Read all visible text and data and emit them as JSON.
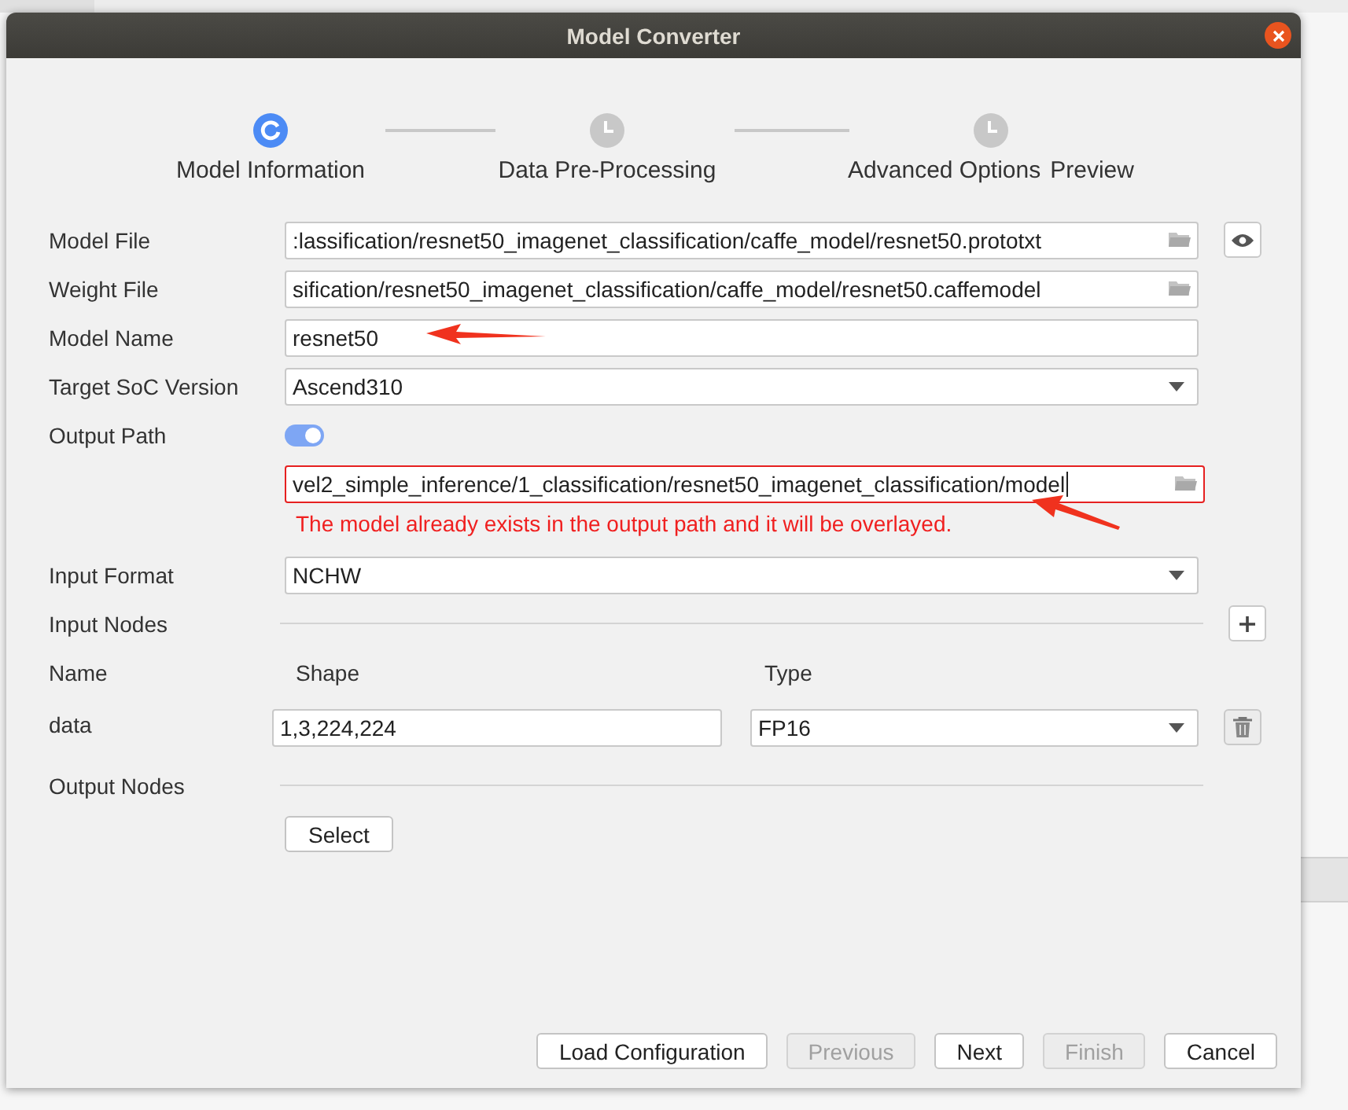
{
  "window": {
    "title": "Model Converter"
  },
  "steps": [
    {
      "label": "Model Information",
      "selected": true
    },
    {
      "label": "Data Pre-Processing",
      "selected": false
    },
    {
      "label": "Advanced Options",
      "selected": false
    }
  ],
  "trailing_step_label": "Preview",
  "model_file": {
    "label": "Model File",
    "value": ":lassification/resnet50_imagenet_classification/caffe_model/resnet50.prototxt"
  },
  "weight_file": {
    "label": "Weight File",
    "value": "sification/resnet50_imagenet_classification/caffe_model/resnet50.caffemodel"
  },
  "model_name": {
    "label": "Model Name",
    "value": "resnet50"
  },
  "target_soc": {
    "label": "Target SoC Version",
    "value": "Ascend310"
  },
  "output_path": {
    "label": "Output Path",
    "on": true,
    "value": "vel2_simple_inference/1_classification/resnet50_imagenet_classification/model",
    "error": true,
    "error_message": "The model already exists in the output path and it will be overlayed."
  },
  "input_format": {
    "label": "Input Format",
    "value": "NCHW"
  },
  "input_nodes": {
    "label": "Input Nodes",
    "columns": [
      "Name",
      "Shape",
      "Type"
    ],
    "rows": [
      {
        "name": "data",
        "shape": "1,3,224,224",
        "type": "FP16"
      }
    ]
  },
  "output_nodes": {
    "label": "Output Nodes",
    "button": "Select"
  },
  "buttons": [
    {
      "label": "Load Configuration",
      "disabled": false
    },
    {
      "label": "Previous",
      "disabled": true
    },
    {
      "label": "Next",
      "disabled": false
    },
    {
      "label": "Finish",
      "disabled": true
    },
    {
      "label": "Cancel",
      "disabled": false
    }
  ]
}
